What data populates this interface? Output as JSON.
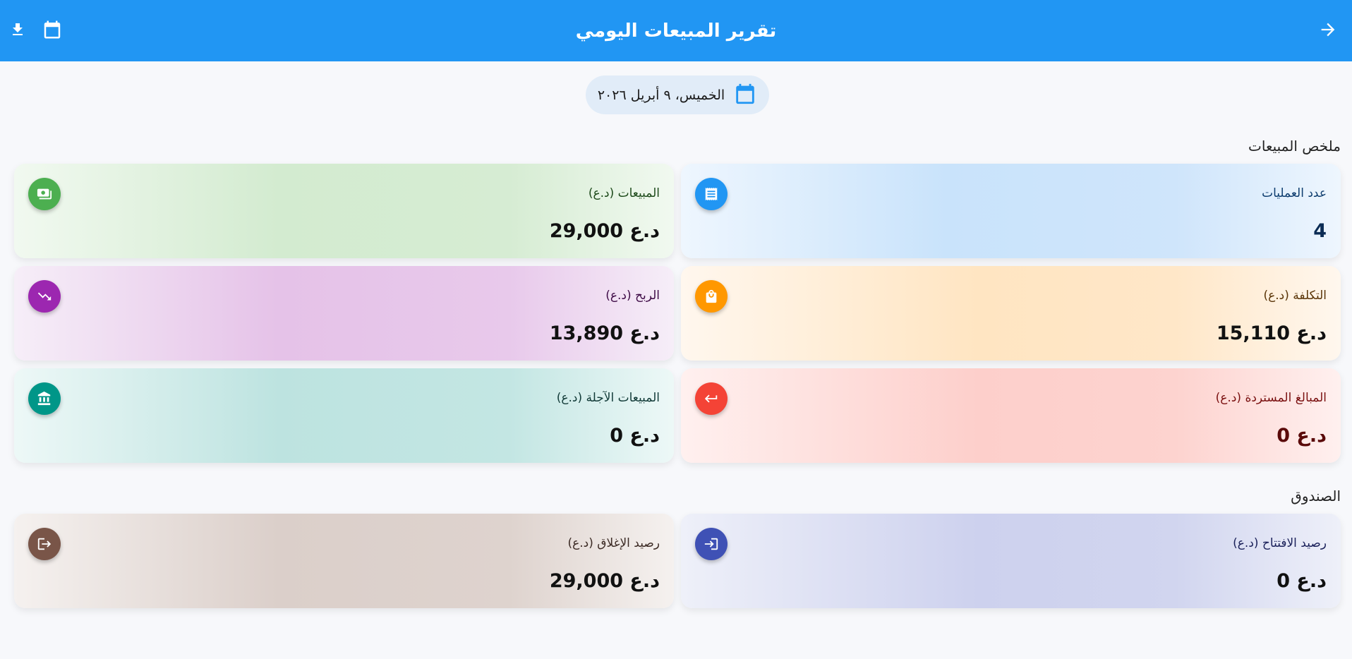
{
  "app_bar": {
    "title": "تقرير المبيعات اليومي",
    "back_icon": "arrow-right-icon",
    "calendar_icon": "calendar-icon",
    "download_icon": "download-icon",
    "color": "#2196f3"
  },
  "date_chip": {
    "text": "الخميس، ٩ أبريل ٢٠٢٦",
    "icon": "calendar-icon"
  },
  "sales_summary": {
    "title": "ملخص المبيعات",
    "cards": [
      {
        "label": "عدد العمليات",
        "value": "4",
        "icon": "receipt-icon",
        "color": "#2196f3"
      },
      {
        "label": "المبيعات (د.ع)",
        "value": "د.ع 29,000",
        "icon": "cash-icon",
        "color": "#4caf50"
      },
      {
        "label": "التكلفة (د.ع)",
        "value": "د.ع 15,110",
        "icon": "shopping-bag-icon",
        "color": "#ff9800"
      },
      {
        "label": "الربح (د.ع)",
        "value": "د.ع 13,890",
        "icon": "trending-icon",
        "color": "#9c27b0"
      },
      {
        "label": "المبالغ المستردة (د.ع)",
        "value": "د.ع 0",
        "icon": "return-arrow-icon",
        "color": "#f44336"
      },
      {
        "label": "المبيعات الآجلة (د.ع)",
        "value": "د.ع 0",
        "icon": "bank-icon",
        "color": "#009688"
      }
    ]
  },
  "cashbox": {
    "title": "الصندوق",
    "cards": [
      {
        "label": "رصيد الافتتاح (د.ع)",
        "value": "د.ع 0",
        "icon": "login-icon",
        "color": "#3f51b5"
      },
      {
        "label": "رصيد الإغلاق (د.ع)",
        "value": "د.ع 29,000",
        "icon": "logout-icon",
        "color": "#795548"
      }
    ]
  }
}
